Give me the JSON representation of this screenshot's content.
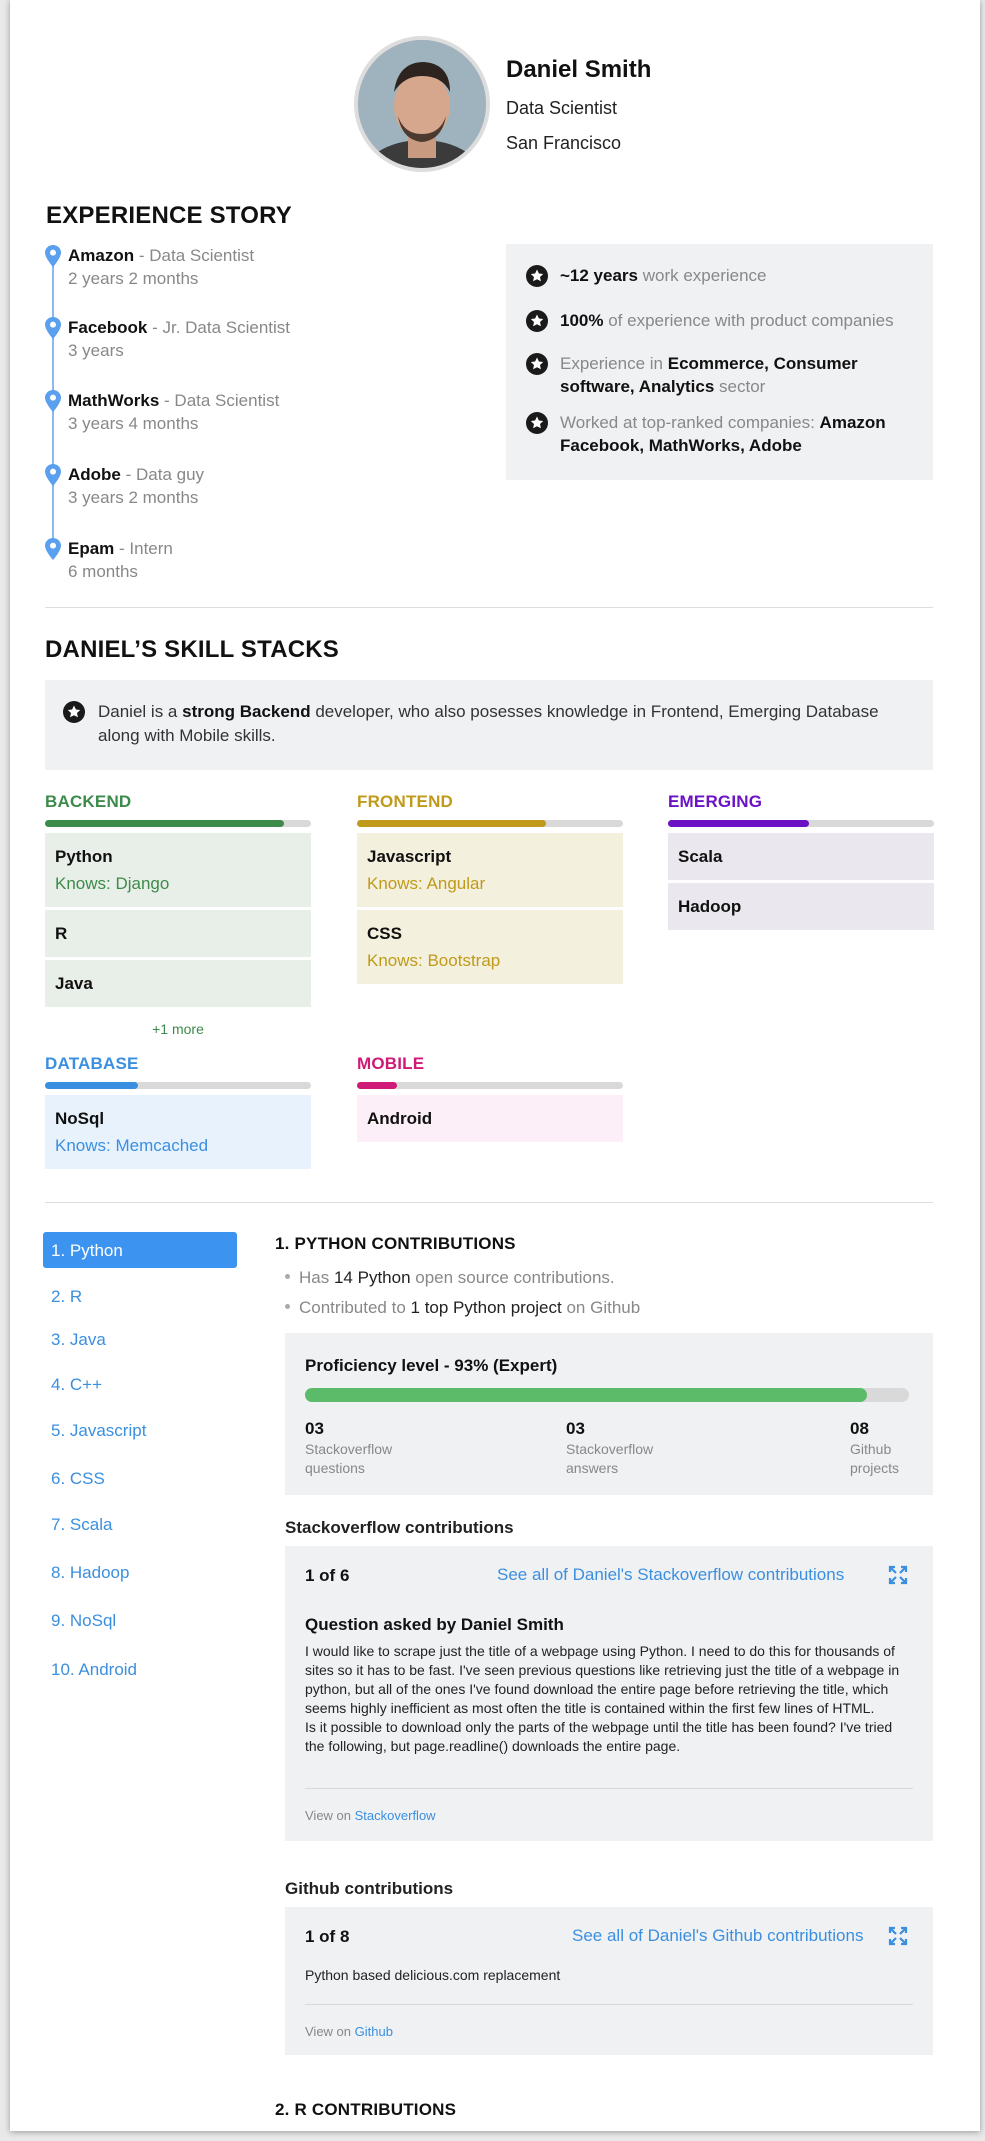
{
  "profile": {
    "name": "Daniel Smith",
    "title": "Data Scientist",
    "location": "San Francisco"
  },
  "experience": {
    "heading": "EXPERIENCE STORY",
    "items": [
      {
        "company": "Amazon",
        "title": "Data Scientist",
        "duration": "2 years 2 months"
      },
      {
        "company": "Facebook",
        "title": "Jr. Data Scientist",
        "duration": "3 years"
      },
      {
        "company": "MathWorks",
        "title": "Data Scientist",
        "duration": "3 years 4 months"
      },
      {
        "company": "Adobe",
        "title": "Data guy",
        "duration": "3 years 2 months"
      },
      {
        "company": "Epam",
        "title": "Intern",
        "duration": "6 months"
      }
    ],
    "separator": " - ",
    "summary": [
      {
        "strong": "~12 years",
        "rest": " work experience"
      },
      {
        "strong": "100%",
        "rest": " of experience with product companies"
      },
      {
        "pre": "Experience in ",
        "strong": "Ecommerce, Consumer software, Analytics",
        "rest": " sector"
      },
      {
        "pre": "Worked at top-ranked companies: ",
        "strong": "Amazon Facebook, MathWorks, Adobe",
        "rest": ""
      }
    ]
  },
  "skills": {
    "heading": "DANIEL’S SKILL STACKS",
    "note_pre": "Daniel is a ",
    "note_strong": "strong Backend",
    "note_rest": " developer, who also posesses knowledge in Frontend, Emerging Database along with Mobile skills.",
    "categories": [
      {
        "name": "BACKEND",
        "color": "#3d8b4a",
        "fill": 0.9,
        "card_bg": "#e8efe9",
        "items": [
          {
            "skill": "Python",
            "knows": "Knows: Django"
          },
          {
            "skill": "R"
          },
          {
            "skill": "Java"
          }
        ],
        "more": "+1 more"
      },
      {
        "name": "FRONTEND",
        "color": "#c09a1a",
        "fill": 0.71,
        "card_bg": "#f4f0de",
        "items": [
          {
            "skill": "Javascript",
            "knows": "Knows: Angular"
          },
          {
            "skill": "CSS",
            "knows": "Knows: Bootstrap"
          }
        ]
      },
      {
        "name": "EMERGING",
        "color": "#6a12c4",
        "fill": 0.53,
        "card_bg": "#eae8ee",
        "items": [
          {
            "skill": "Scala"
          },
          {
            "skill": "Hadoop"
          }
        ]
      },
      {
        "name": "DATABASE",
        "color": "#3b8fe0",
        "fill": 0.35,
        "card_bg": "#e7f2fd",
        "items": [
          {
            "skill": "NoSql",
            "knows": "Knows: Memcached"
          }
        ]
      },
      {
        "name": "MOBILE",
        "color": "#d01a78",
        "fill": 0.15,
        "card_bg": "#fdeff7",
        "items": [
          {
            "skill": "Android"
          }
        ]
      }
    ]
  },
  "nav": [
    "1. Python",
    "2. R",
    "3. Java",
    "4. C++",
    "5. Javascript",
    "6. CSS",
    "7. Scala",
    "8. Hadoop",
    "9. NoSql",
    "10. Android"
  ],
  "python": {
    "heading": "1. PYTHON CONTRIBUTIONS",
    "b1_pre": "Has ",
    "b1_dark": "14 Python",
    "b1_rest": " open source contributions.",
    "b2_pre": "Contributed to ",
    "b2_dark": "1 top Python project",
    "b2_rest": " on Github",
    "proficiency_label": "Proficiency level - 93% (Expert)",
    "proficiency": 0.93,
    "stats": [
      {
        "n": "03",
        "l1": "Stackoverflow",
        "l2": "questions"
      },
      {
        "n": "03",
        "l1": "Stackoverflow",
        "l2": "answers"
      },
      {
        "n": "08",
        "l1": "Github",
        "l2": "projects"
      }
    ],
    "so": {
      "title": "Stackoverflow contributions",
      "count": "1 of 6",
      "see_all": "See all of Daniel's Stackoverflow contributions",
      "question_title": "Question asked by Daniel Smith",
      "body": "I would like to scrape just the title of a webpage using Python. I need to do this for thousands of sites so it has to be fast. I've seen previous questions like retrieving just the title of a webpage in python, but all of the ones I've found download the entire page before retrieving the title, which seems highly inefficient as most often the title is contained within the first few lines of HTML.\nIs it possible to download only the parts of the webpage until the title has been found? I've tried the following, but page.readline() downloads the entire page.",
      "view_pre": "View on ",
      "view_link": "Stackoverflow"
    },
    "gh": {
      "title": "Github contributions",
      "count": "1 of 8",
      "see_all": "See all of Daniel's Github contributions",
      "body": "Python based delicious.com replacement",
      "view_pre": "View on ",
      "view_link": "Github"
    }
  },
  "next_heading": "2. R CONTRIBUTIONS"
}
